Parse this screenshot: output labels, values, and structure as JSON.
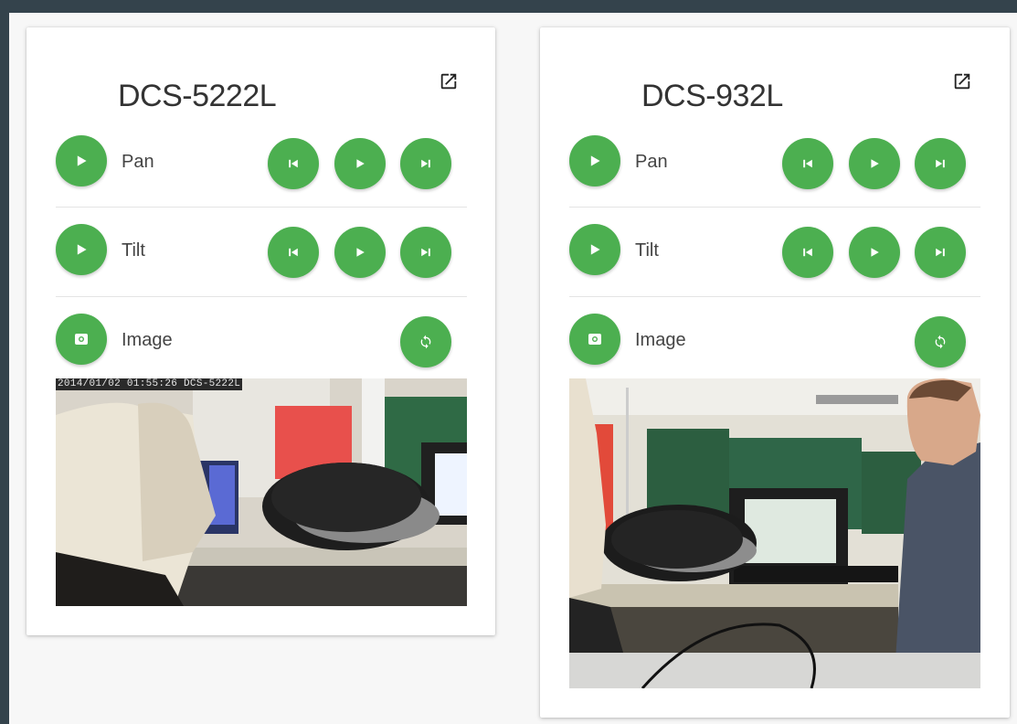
{
  "colors": {
    "accent": "#4caf50",
    "frame": "#34434c",
    "background": "#f7f7f7"
  },
  "cameras": [
    {
      "name": "DCS-5222L",
      "timestamp": "2014/01/02 01:55:26 DCS-5222L",
      "pan": {
        "label": "Pan"
      },
      "tilt": {
        "label": "Tilt"
      },
      "image": {
        "label": "Image"
      }
    },
    {
      "name": "DCS-932L",
      "pan": {
        "label": "Pan"
      },
      "tilt": {
        "label": "Tilt"
      },
      "image": {
        "label": "Image"
      }
    }
  ],
  "icons": {
    "external": "open-in-new-icon",
    "play": "play-icon",
    "prev": "skip-previous-icon",
    "next": "skip-next-icon",
    "camera": "camera-icon",
    "refresh": "refresh-icon"
  }
}
